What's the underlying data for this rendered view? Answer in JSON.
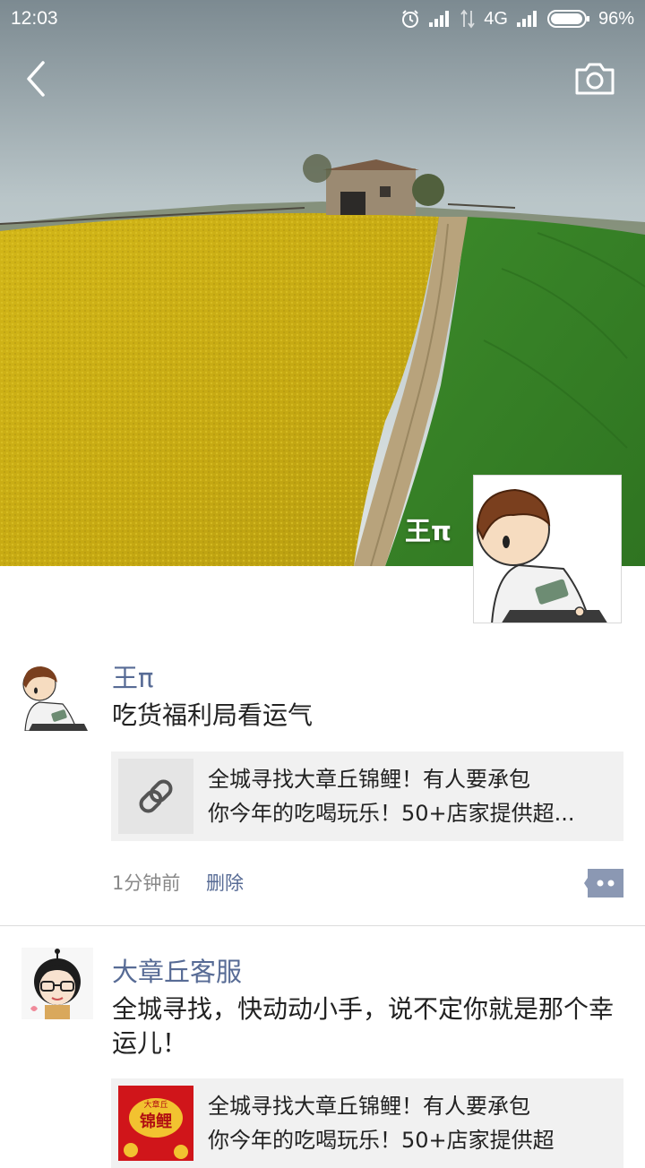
{
  "status_bar": {
    "time": "12:03",
    "network": "4G",
    "battery": "96%",
    "icons": [
      "alarm-icon",
      "signal-icon",
      "data-arrows-icon",
      "signal-icon",
      "battery-icon"
    ]
  },
  "header": {
    "back_icon": "chevron-left-icon",
    "camera_icon": "camera-icon"
  },
  "profile": {
    "name": "王π"
  },
  "posts": [
    {
      "author": "王π",
      "text": "吃货福利局看运气",
      "share": {
        "thumb_icon": "link-icon",
        "title_line1": "全城寻找大章丘锦鲤！有人要承包",
        "title_line2": "你今年的吃喝玩乐！50+店家提供超..."
      },
      "time": "1分钟前",
      "delete_label": "删除",
      "comment_icon": "comment-dots-icon"
    },
    {
      "author": "大章丘客服",
      "text": "全城寻找，快动动小手，说不定你就是那个幸运儿！",
      "share": {
        "thumb_text": "大章丘",
        "thumb_title": "锦鲤",
        "title_line1": "全城寻找大章丘锦鲤！有人要承包",
        "title_line2": "你今年的吃喝玩乐！50+店家提供超"
      }
    }
  ],
  "colors": {
    "link_blue": "#576b95",
    "field_yellow": "#c9b015",
    "field_green": "#3f8a2c"
  }
}
